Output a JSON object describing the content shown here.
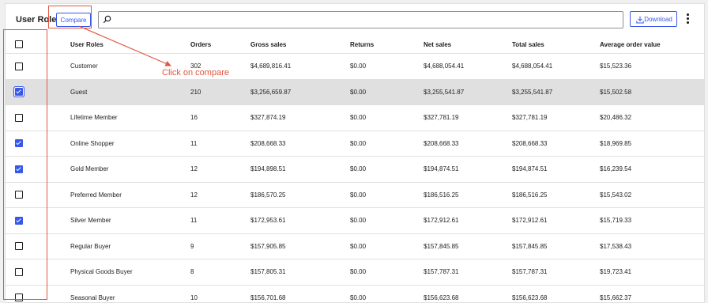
{
  "header": {
    "title": "User Roles",
    "compare_label": "Compare",
    "search_placeholder": "",
    "download_label": "Download"
  },
  "table": {
    "columns": [
      "User Roles",
      "Orders",
      "Gross sales",
      "Returns",
      "Net sales",
      "Total sales",
      "Average order value"
    ],
    "rows": [
      {
        "checked": false,
        "cells": [
          "Customer",
          "302",
          "$4,689,816.41",
          "$0.00",
          "$4,688,054.41",
          "$4,688,054.41",
          "$15,523.36"
        ]
      },
      {
        "checked": true,
        "cells": [
          "Guest",
          "210",
          "$3,256,659.87",
          "$0.00",
          "$3,255,541.87",
          "$3,255,541.87",
          "$15,502.58"
        ]
      },
      {
        "checked": false,
        "cells": [
          "Lifetime Member",
          "16",
          "$327,874.19",
          "$0.00",
          "$327,781.19",
          "$327,781.19",
          "$20,486.32"
        ]
      },
      {
        "checked": true,
        "cells": [
          "Online Shopper",
          "11",
          "$208,668.33",
          "$0.00",
          "$208,668.33",
          "$208,668.33",
          "$18,969.85"
        ]
      },
      {
        "checked": true,
        "cells": [
          "Gold Member",
          "12",
          "$194,898.51",
          "$0.00",
          "$194,874.51",
          "$194,874.51",
          "$16,239.54"
        ]
      },
      {
        "checked": false,
        "cells": [
          "Preferred Member",
          "12",
          "$186,570.25",
          "$0.00",
          "$186,516.25",
          "$186,516.25",
          "$15,543.02"
        ]
      },
      {
        "checked": true,
        "cells": [
          "Silver Member",
          "11",
          "$172,953.61",
          "$0.00",
          "$172,912.61",
          "$172,912.61",
          "$15,719.33"
        ]
      },
      {
        "checked": false,
        "cells": [
          "Regular Buyer",
          "9",
          "$157,905.85",
          "$0.00",
          "$157,845.85",
          "$157,845.85",
          "$17,538.43"
        ]
      },
      {
        "checked": false,
        "cells": [
          "Physical Goods Buyer",
          "8",
          "$157,805.31",
          "$0.00",
          "$157,787.31",
          "$157,787.31",
          "$19,723.41"
        ]
      },
      {
        "checked": false,
        "cells": [
          "Seasonal Buyer",
          "10",
          "$156,701.68",
          "$0.00",
          "$156,623.68",
          "$156,623.68",
          "$15,662.37"
        ]
      }
    ]
  },
  "annotation": {
    "text": "Click on compare",
    "color": "#e2553f"
  },
  "colors": {
    "accent": "#3858e9",
    "selected_row": "#e0e0e0"
  }
}
